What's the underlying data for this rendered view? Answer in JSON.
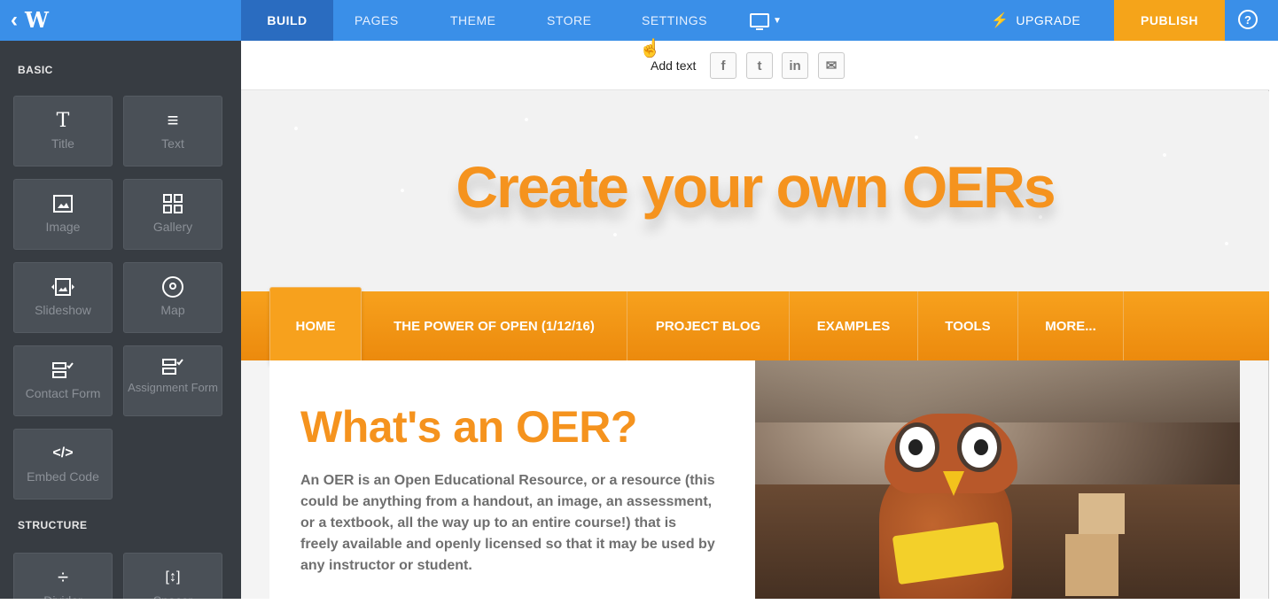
{
  "topbar": {
    "back_icon": "‹",
    "logo": "W",
    "tabs": [
      "BUILD",
      "PAGES",
      "THEME",
      "STORE",
      "SETTINGS"
    ],
    "upgrade": "UPGRADE",
    "publish": "PUBLISH",
    "help": "?"
  },
  "sidebar": {
    "sections": {
      "basic": "BASIC",
      "structure": "STRUCTURE"
    },
    "items": [
      {
        "label": "Title",
        "icon": "T"
      },
      {
        "label": "Text",
        "icon": "≡"
      },
      {
        "label": "Image",
        "icon": "image-icon"
      },
      {
        "label": "Gallery",
        "icon": "gallery-icon"
      },
      {
        "label": "Slideshow",
        "icon": "slideshow-icon"
      },
      {
        "label": "Map",
        "icon": "map-pin-icon"
      },
      {
        "label": "Contact Form",
        "icon": "form-icon"
      },
      {
        "label": "Assignment Form",
        "icon": "form-icon"
      },
      {
        "label": "Embed Code",
        "icon": "</>"
      },
      {
        "label": "Divider",
        "icon": "÷"
      },
      {
        "label": "Spacer",
        "icon": "[↕]"
      }
    ]
  },
  "share": {
    "add_text": "Add text",
    "buttons": [
      "f",
      "t",
      "in",
      "✉"
    ]
  },
  "site": {
    "hero_title": "Create your own OERs",
    "nav": [
      "HOME",
      "THE POWER OF OPEN (1/12/16)",
      "PROJECT BLOG",
      "EXAMPLES",
      "TOOLS",
      "MORE..."
    ],
    "heading": "What's an OER?",
    "paragraph": "An OER is an Open Educational Resource, or a resource (this could be anything from a handout, an image, an assessment, or a textbook, all the way up to an entire course!) that is freely available and openly licensed so that it may be used by any instructor or student."
  },
  "colors": {
    "topbar": "#3a8fe8",
    "build_active": "#2a6cc0",
    "publish": "#f5a41a",
    "sidebar": "#373c42",
    "tile": "#4a5057",
    "accent_orange": "#f5931e"
  }
}
